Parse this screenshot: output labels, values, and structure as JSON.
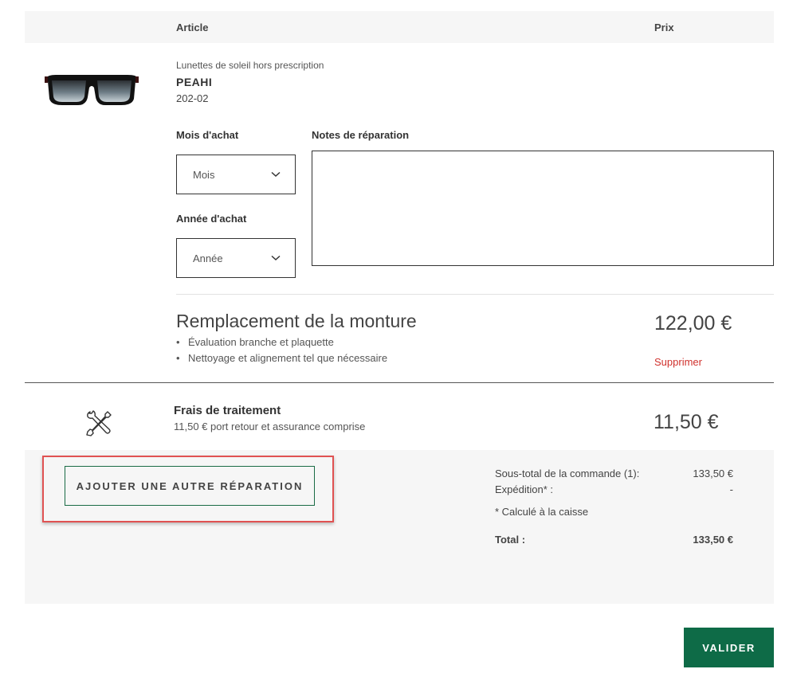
{
  "table_header": {
    "article": "Article",
    "price": "Prix"
  },
  "product": {
    "category": "Lunettes de soleil hors prescription",
    "name": "PEAHI",
    "code": "202-02",
    "image_icon": "sunglasses-image"
  },
  "form": {
    "month_label": "Mois d'achat",
    "month_value": "Mois",
    "year_label": "Année d'achat",
    "year_value": "Année",
    "notes_label": "Notes de réparation",
    "notes_value": ""
  },
  "service": {
    "title": "Remplacement de la monture",
    "bullets": [
      "Évaluation branche et plaquette",
      "Nettoyage et alignement tel que nécessaire"
    ],
    "price": "122,00 €",
    "remove_label": "Supprimer"
  },
  "processing_fee": {
    "icon": "tools-icon",
    "title": "Frais de traitement",
    "description": "11,50 €  port retour et assurance comprise",
    "price": "11,50 €"
  },
  "actions": {
    "add_repair_label": "AJOUTER UNE AUTRE RÉPARATION",
    "validate_label": "VALIDER"
  },
  "summary": {
    "subtotal_label": "Sous-total de la commande (1):",
    "subtotal_value": "133,50 €",
    "shipping_label": "Expédition* :",
    "shipping_value": "-",
    "shipping_note": "* Calculé à la caisse",
    "total_label": "Total :",
    "total_value": "133,50 €"
  },
  "colors": {
    "accent_green": "#0e6b47",
    "remove_red": "#d0312d",
    "highlight_red": "#e05252"
  }
}
